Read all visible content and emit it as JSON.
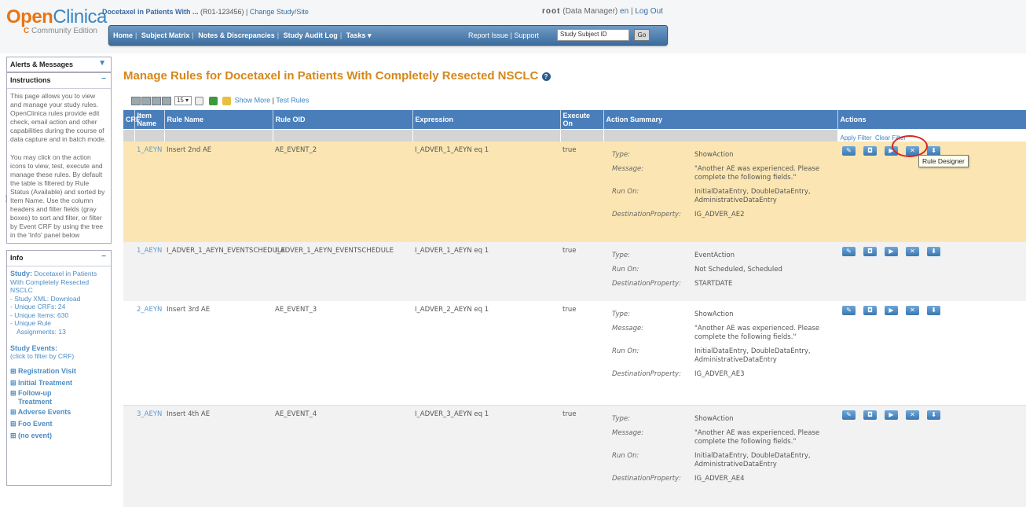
{
  "header": {
    "logo_open": "Open",
    "logo_clinica": "Clinica",
    "logo_edition": "Community Edition",
    "study_name": "Docetaxel in Patients With ...",
    "study_id": "(R01-123456)",
    "change_study": "Change Study/Site",
    "user": "root",
    "user_role": "(Data Manager)",
    "lang": "en",
    "logout": "Log Out"
  },
  "nav": {
    "items": [
      "Home",
      "Subject Matrix",
      "Notes & Discrepancies",
      "Study Audit Log",
      "Tasks ▾"
    ],
    "report_issue": "Report Issue",
    "support": "Support",
    "search_value": "Study Subject ID",
    "go": "Go"
  },
  "sidebar": {
    "alerts_title": "Alerts & Messages",
    "instructions_title": "Instructions",
    "instructions_p1": "This page allows you to view and manage your study rules. OpenClinica rules provide edit check, email action and other capabilities during the course of data capture and in batch mode.",
    "instructions_p2": "You may click on the action icons to view, test, execute and manage these rules. By default the table is filtered by Rule Status (Available) and sorted by Item Name. Use the column headers and filter fields (gray boxes) to sort and filter, or filter by Event CRF by using the tree in the 'Info' panel below",
    "info_title": "Info",
    "study_label": "Study:",
    "study_value": "Docetaxel in Patients With Completely Resected NSCLC",
    "study_xml": "- Study XML: Download",
    "unique_crfs": "- Unique CRFs: 24",
    "unique_items": "- Unique Items: 630",
    "unique_rule": "- Unique Rule",
    "assignments": "Assignments: 13",
    "study_events": "Study Events:",
    "study_events_hint": "(click to filter by CRF)",
    "events": [
      "⊞ Registration Visit",
      "⊞ Initial Treatment",
      "⊞ Follow-up",
      "Treatment",
      "⊞ Adverse Events",
      "⊞ Foo Event",
      "⊞ (no event)"
    ]
  },
  "main": {
    "title": "Manage Rules for Docetaxel in Patients With Completely Resected NSCLC",
    "page_size": "15 ▾",
    "show_more": "Show More",
    "test_rules": "Test Rules",
    "apply_filter": "Apply Filter",
    "clear_filter": "Clear Filter",
    "tooltip": "Rule Designer",
    "columns": [
      "CRF",
      "Item Name",
      "Rule Name",
      "Rule OID",
      "Expression",
      "Execute On",
      "Action Summary",
      "Actions"
    ],
    "rows": [
      {
        "item": "1_AEYN",
        "rule_name": "Insert 2nd AE",
        "rule_oid": "AE_EVENT_2",
        "expression": "I_ADVER_1_AEYN eq 1",
        "execute_on": "true",
        "summary": [
          {
            "k": "Type:",
            "v": "ShowAction"
          },
          {
            "k": "Message:",
            "v": "\"Another AE was experienced. Please complete the following fields.\""
          },
          {
            "k": "Run On:",
            "v": "InitialDataEntry, DoubleDataEntry, AdministrativeDataEntry"
          },
          {
            "k": "DestinationProperty:",
            "v": "IG_ADVER_AE2"
          }
        ]
      },
      {
        "item": "1_AEYN",
        "rule_name": "I_ADVER_1_AEYN_EVENTSCHEDULE",
        "rule_oid": "I_ADVER_1_AEYN_EVENTSCHEDULE",
        "expression": "I_ADVER_1_AEYN eq 1",
        "execute_on": "true",
        "summary": [
          {
            "k": "Type:",
            "v": "EventAction"
          },
          {
            "k": "Run On:",
            "v": "Not Scheduled, Scheduled"
          },
          {
            "k": "DestinationProperty:",
            "v": "STARTDATE"
          }
        ]
      },
      {
        "item": "2_AEYN",
        "rule_name": "Insert 3rd AE",
        "rule_oid": "AE_EVENT_3",
        "expression": "I_ADVER_2_AEYN eq 1",
        "execute_on": "true",
        "summary": [
          {
            "k": "Type:",
            "v": "ShowAction"
          },
          {
            "k": "Message:",
            "v": "\"Another AE was experienced. Please complete the following fields.\""
          },
          {
            "k": "Run On:",
            "v": "InitialDataEntry, DoubleDataEntry, AdministrativeDataEntry"
          },
          {
            "k": "DestinationProperty:",
            "v": "IG_ADVER_AE3"
          }
        ]
      },
      {
        "item": "3_AEYN",
        "rule_name": "Insert 4th AE",
        "rule_oid": "AE_EVENT_4",
        "expression": "I_ADVER_3_AEYN eq 1",
        "execute_on": "true",
        "summary": [
          {
            "k": "Type:",
            "v": "ShowAction"
          },
          {
            "k": "Message:",
            "v": "\"Another AE was experienced. Please complete the following fields.\""
          },
          {
            "k": "Run On:",
            "v": "InitialDataEntry, DoubleDataEntry, AdministrativeDataEntry"
          },
          {
            "k": "DestinationProperty:",
            "v": "IG_ADVER_AE4"
          }
        ]
      }
    ],
    "action_icons": [
      "edit-icon",
      "view-icon",
      "run-icon",
      "remove-icon",
      "download-icon"
    ]
  }
}
